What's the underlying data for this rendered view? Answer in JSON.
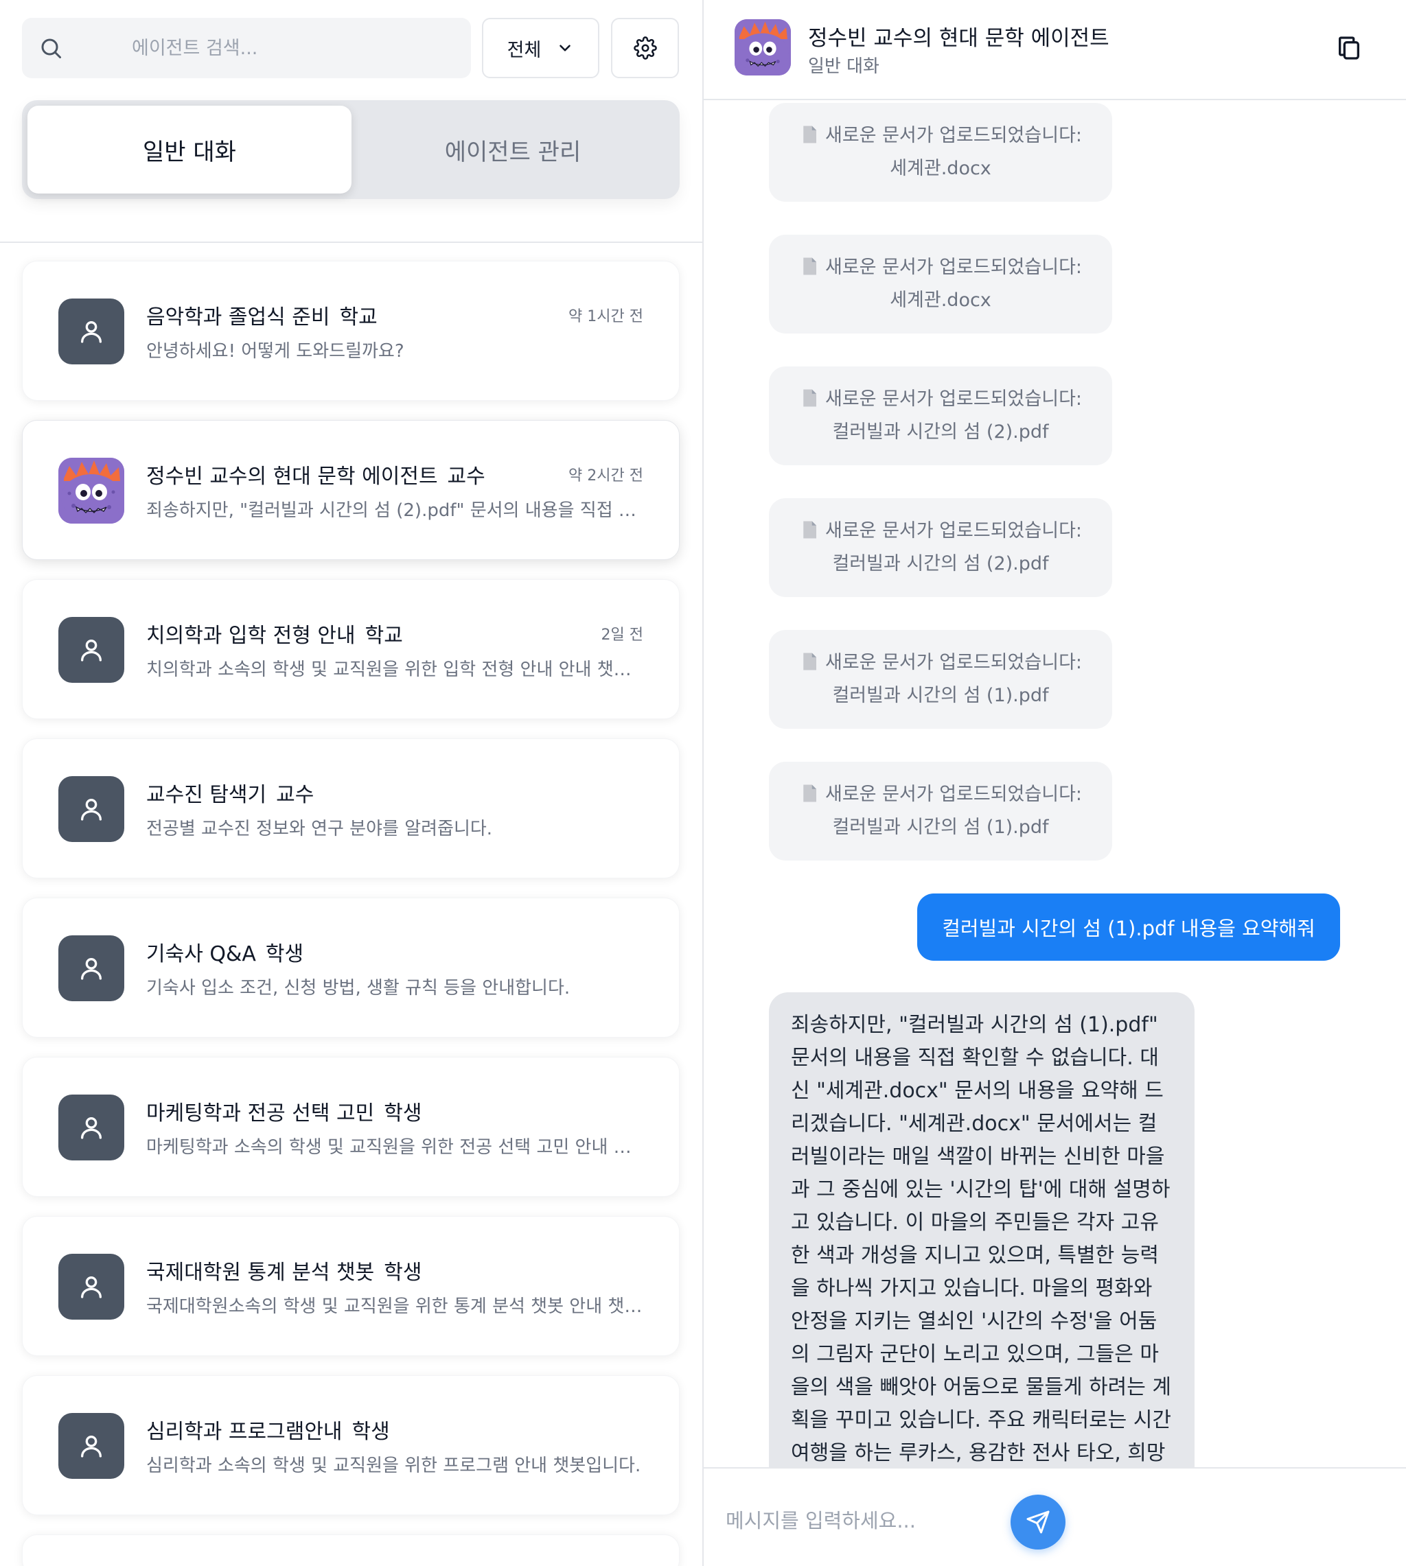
{
  "sidebar": {
    "search": {
      "placeholder": "에이전트 검색..."
    },
    "filter": {
      "label": "전체"
    },
    "tabs": [
      {
        "label": "일반 대화",
        "active": true
      },
      {
        "label": "에이전트 관리",
        "active": false
      }
    ],
    "conversations": [
      {
        "title": "음악학과 졸업식 준비",
        "tag": "학교",
        "time": "약 1시간 전",
        "preview": "안녕하세요! 어떻게 도와드릴까요?",
        "avatar": "user-icon"
      },
      {
        "title": "정수빈 교수의 현대 문학 에이전트",
        "tag": "교수",
        "time": "약 2시간 전",
        "preview": "죄송하지만, \"컬러빌과 시간의 섬 (2).pdf\" 문서의 내용을 직접 확인할 수 없습니다.",
        "avatar": "monster-avatar"
      },
      {
        "title": "치의학과 입학 전형 안내",
        "tag": "학교",
        "time": "2일 전",
        "preview": "치의학과 소속의 학생 및 교직원을 위한 입학 전형 안내 안내 챗봇입니다.",
        "avatar": "user-icon"
      },
      {
        "title": "교수진 탐색기",
        "tag": "교수",
        "time": "",
        "preview": "전공별 교수진 정보와 연구 분야를 알려줍니다.",
        "avatar": "user-icon"
      },
      {
        "title": "기숙사 Q&A",
        "tag": "학생",
        "time": "",
        "preview": "기숙사 입소 조건, 신청 방법, 생활 규칙 등을 안내합니다.",
        "avatar": "user-icon"
      },
      {
        "title": "마케팅학과 전공 선택 고민",
        "tag": "학생",
        "time": "",
        "preview": "마케팅학과 소속의 학생 및 교직원을 위한 전공 선택 고민 안내 챗봇입니다.",
        "avatar": "user-icon"
      },
      {
        "title": "국제대학원 통계 분석 챗봇",
        "tag": "학생",
        "time": "",
        "preview": "국제대학원소속의 학생 및 교직원을 위한 통계 분석 챗봇 안내 챗봇입니다.",
        "avatar": "user-icon"
      },
      {
        "title": "심리학과 프로그램안내",
        "tag": "학생",
        "time": "",
        "preview": "심리학과 소속의 학생 및 교직원을 위한 프로그램 안내 챗봇입니다.",
        "avatar": "user-icon"
      }
    ]
  },
  "chat": {
    "title": "정수빈 교수의 현대 문학 에이전트",
    "subtitle": "일반 대화",
    "system_messages": [
      {
        "line1": "새로운 문서가 업로드되었습니다:",
        "file": "세계관.docx"
      },
      {
        "line1": "새로운 문서가 업로드되었습니다:",
        "file": "세계관.docx"
      },
      {
        "line1": "새로운 문서가 업로드되었습니다:",
        "file": "컬러빌과 시간의 섬 (2).pdf"
      },
      {
        "line1": "새로운 문서가 업로드되었습니다:",
        "file": "컬러빌과 시간의 섬 (2).pdf"
      },
      {
        "line1": "새로운 문서가 업로드되었습니다:",
        "file": "컬러빌과 시간의 섬 (1).pdf"
      },
      {
        "line1": "새로운 문서가 업로드되었습니다:",
        "file": "컬러빌과 시간의 섬 (1).pdf"
      }
    ],
    "user_message": "컬러빌과 시간의 섬 (1).pdf 내용을 요약해줘",
    "bot_message": "죄송하지만, \"컬러빌과 시간의 섬 (1).pdf\" 문서의 내용을 직접 확인할 수 없습니다. 대신 \"세계관.docx\" 문서의 내용을 요약해 드리겠습니다. \"세계관.docx\" 문서에서는 컬러빌이라는 매일 색깔이 바뀌는 신비한 마을과 그 중심에 있는 '시간의 탑'에 대해 설명하고 있습니다. 이 마을의 주민들은 각자 고유한 색과 개성을 지니고 있으며, 특별한 능력을 하나씩 가지고 있습니다. 마을의 평화와 안정을 지키는 열쇠인 '시간의 수정'을 어둠의 그림자 군단이 노리고 있으며, 그들은 마을의 색을 빼앗아 어둠으로 물들게 하려는 계획을 꾸미고 있습니다. 주요 캐릭터로는 시간 여행을 하는 루카스, 용감한 전사 타오, 희망을 주는 소녀 레",
    "input": {
      "placeholder": "메시지를 입력하세요..."
    }
  },
  "colors": {
    "accent": "#1a7ff5",
    "send_button": "#3b8ef0",
    "avatar_bg": "#4b5563",
    "monster": "#8b6fc9"
  }
}
